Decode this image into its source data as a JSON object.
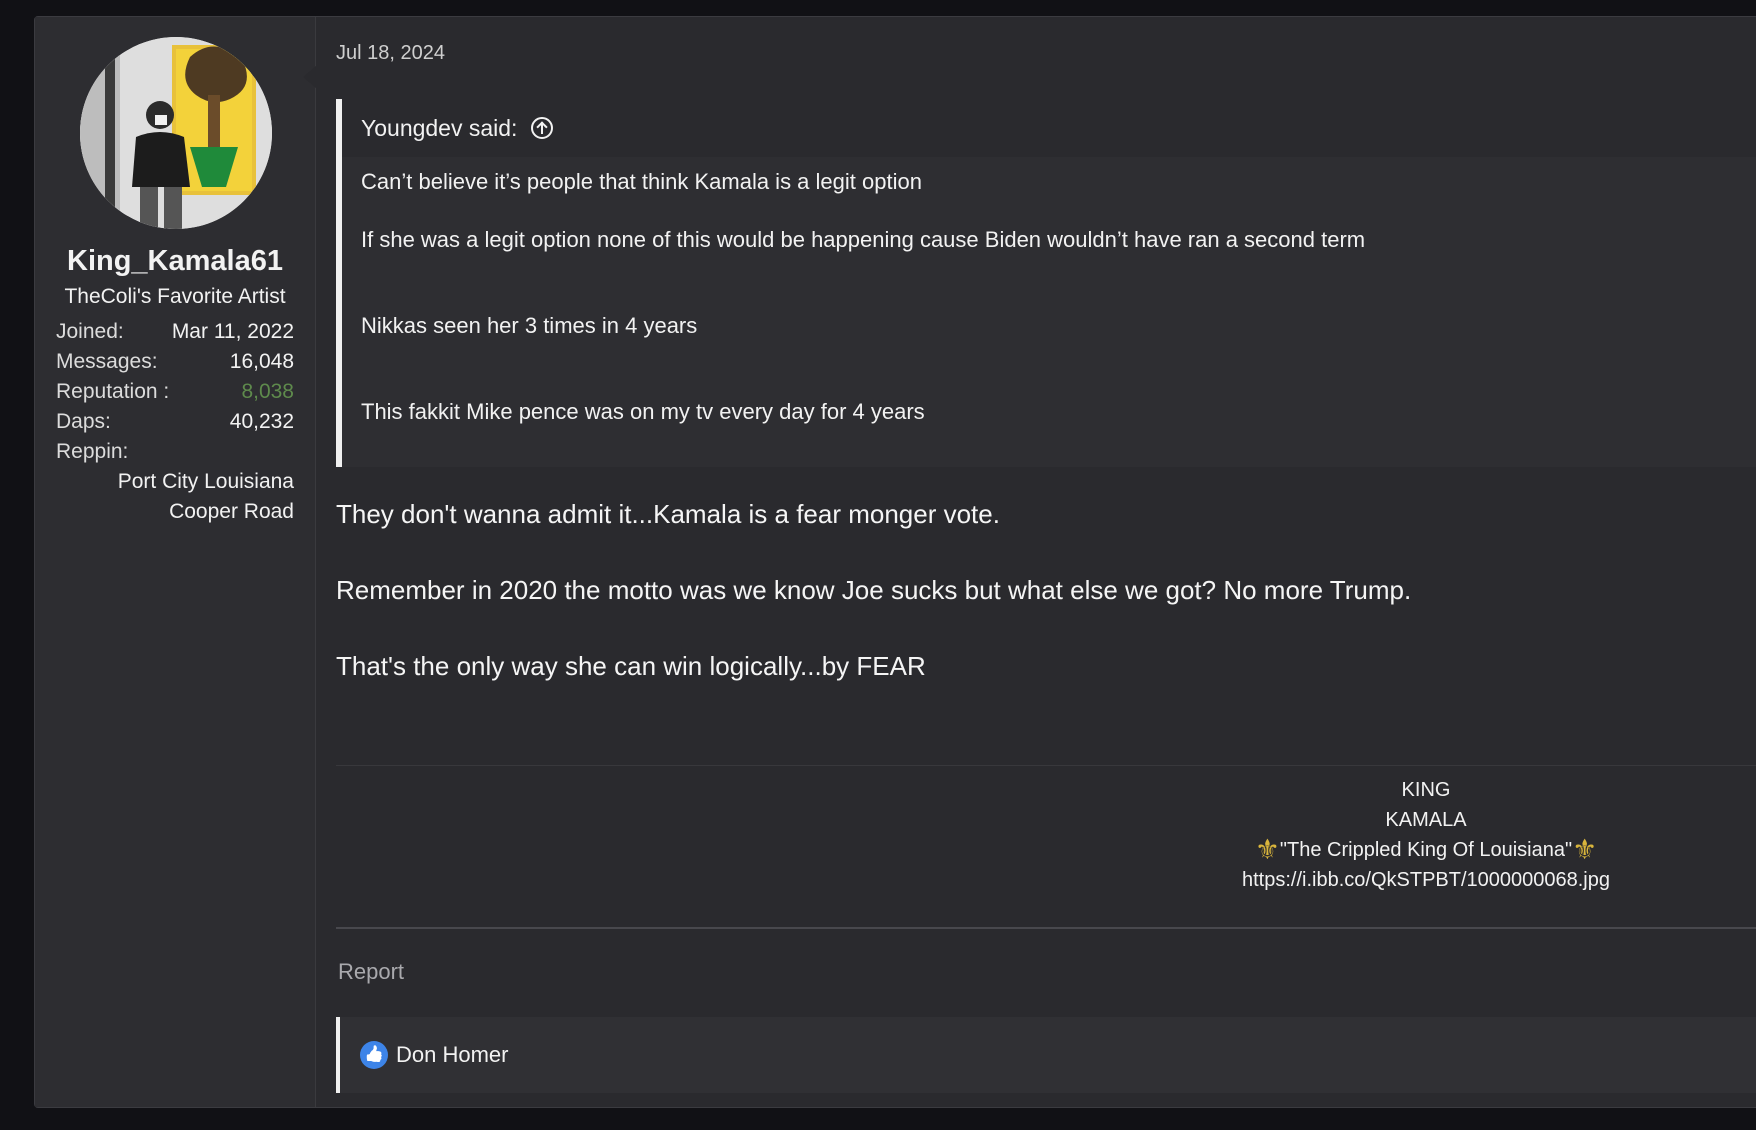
{
  "user": {
    "name": "King_Kamala61",
    "title": "TheColi's Favorite Artist",
    "stats": [
      {
        "label": "Joined:",
        "value": "Mar 11, 2022"
      },
      {
        "label": "Messages:",
        "value": "16,048"
      },
      {
        "label": "Reputation :",
        "value": "8,038"
      },
      {
        "label": "Daps:",
        "value": "40,232"
      },
      {
        "label": "Reppin:",
        "value": ""
      }
    ],
    "reppin_lines": [
      "Port City Louisiana",
      "Cooper Road"
    ]
  },
  "post": {
    "date": "Jul 18, 2024",
    "quote": {
      "author_said": "Youngdev said:",
      "lines": [
        "Can’t believe it’s people that think Kamala is a legit option",
        "If she was a legit option none of this would be happening cause Biden wouldn’t have ran a second term",
        "Nikkas seen her 3 times in 4 years",
        "This fakkit Mike pence was on my tv every day for 4 years"
      ]
    },
    "body": [
      "They don't wanna admit it...Kamala is a fear monger vote.",
      "Remember in 2020 the motto was we know Joe sucks but what else we got? No more Trump.",
      "That's the only way she can win logically...by FEAR"
    ],
    "signature": {
      "line1": "KING",
      "line2": "KAMALA",
      "line3": "\"The Crippled King Of Louisiana\"",
      "line4": "https://i.ibb.co/QkSTPBT/1000000068.jpg"
    },
    "report_label": "Report",
    "reaction_user": "Don Homer"
  },
  "colors": {
    "reputation": "#5e8a4c",
    "like_badge": "#3d84e8",
    "fleur": "#d9b53c"
  }
}
